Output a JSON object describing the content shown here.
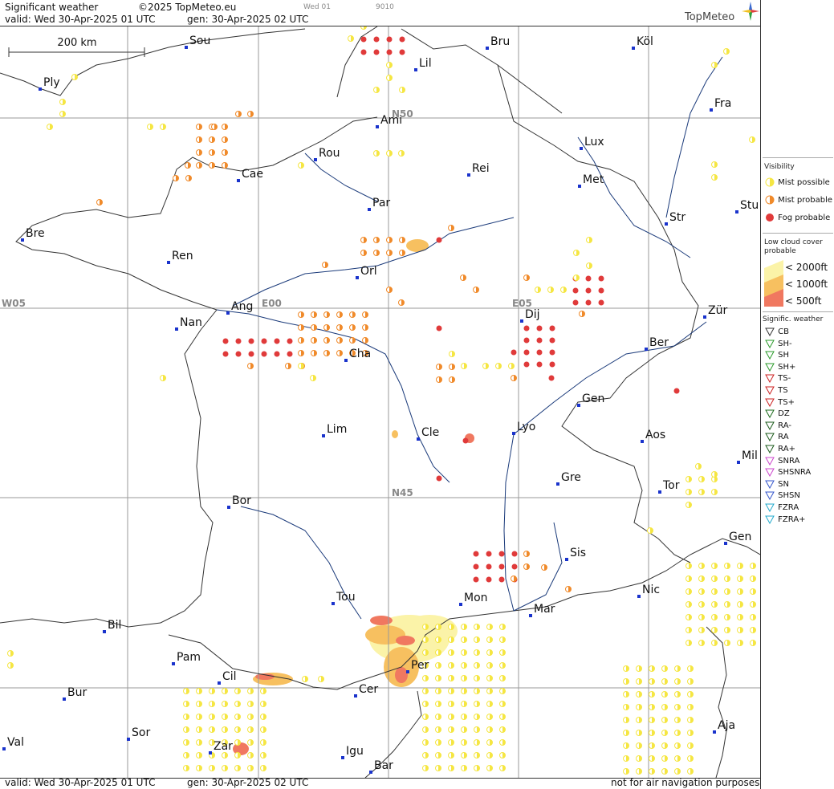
{
  "header": {
    "title": "Significant weather",
    "copyright": "©2025 TopMeteo.eu",
    "valid": "valid:  Wed  30-Apr-2025  01 UTC",
    "gen": "gen:  30-Apr-2025  02 UTC",
    "small_day": "Wed 01",
    "small_code": "9010",
    "brand": "TopMeteo"
  },
  "scale_bar": {
    "label": "200 km"
  },
  "grid_labels": [
    {
      "id": "n50",
      "text": "N50"
    },
    {
      "id": "n45",
      "text": "N45"
    },
    {
      "id": "w05",
      "text": "W05"
    },
    {
      "id": "e00",
      "text": "E00"
    },
    {
      "id": "e05",
      "text": "E05"
    }
  ],
  "cities": [
    "Sou",
    "Bru",
    "Köl",
    "Ply",
    "Lil",
    "Ami",
    "Fra",
    "Rou",
    "Lux",
    "Cae",
    "Rei",
    "Met",
    "Par",
    "Stu",
    "Bre",
    "Str",
    "Ren",
    "Orl",
    "Ang",
    "Dij",
    "Zür",
    "Nan",
    "Ber",
    "Cha",
    "Gen",
    "Lim",
    "Cle",
    "Lyo",
    "Aos",
    "Mil",
    "Gre",
    "Tor",
    "Bor",
    "Gen",
    "Sis",
    "Tou",
    "Nic",
    "Mon",
    "Mar",
    "Bil",
    "Pam",
    "Per",
    "Cil",
    "Bur",
    "Cer",
    "Sor",
    "Aja",
    "Val",
    "Zar",
    "Igu",
    "Bar"
  ],
  "legend": {
    "visibility_title": "Visibility",
    "visibility": [
      {
        "label": "Mist possible",
        "color": "#f5e642"
      },
      {
        "label": "Mist probable",
        "color": "#f08a2a"
      },
      {
        "label": "Fog probable",
        "color": "#e03a3a"
      }
    ],
    "low_cloud_title_1": "Low cloud cover",
    "low_cloud_title_2": "probable",
    "low_cloud": [
      {
        "label": "< 2000ft",
        "color": "#fbf3a8"
      },
      {
        "label": "< 1000ft",
        "color": "#f7c060"
      },
      {
        "label": "<   500ft",
        "color": "#f07860"
      }
    ],
    "sig_title": "Signific. weather",
    "sig": [
      {
        "label": "CB",
        "color": "#333333"
      },
      {
        "label": "SH-",
        "color": "#2a9a2a"
      },
      {
        "label": "SH",
        "color": "#2a9a2a"
      },
      {
        "label": "SH+",
        "color": "#2a9a2a"
      },
      {
        "label": "TS-",
        "color": "#cc2222"
      },
      {
        "label": "TS",
        "color": "#cc2222"
      },
      {
        "label": "TS+",
        "color": "#cc2222"
      },
      {
        "label": "DZ",
        "color": "#1a6a1a"
      },
      {
        "label": "RA-",
        "color": "#1a5a1a"
      },
      {
        "label": "RA",
        "color": "#1a5a1a"
      },
      {
        "label": "RA+",
        "color": "#1a5a1a"
      },
      {
        "label": "SNRA",
        "color": "#cc44cc"
      },
      {
        "label": "SHSNRA",
        "color": "#cc44cc"
      },
      {
        "label": "SN",
        "color": "#3355cc"
      },
      {
        "label": "SHSN",
        "color": "#3355cc"
      },
      {
        "label": "FZRA",
        "color": "#22aacc"
      },
      {
        "label": "FZRA+",
        "color": "#22aacc"
      }
    ]
  },
  "footer": {
    "valid": "valid:  Wed  30-Apr-2025  01 UTC",
    "gen": "gen:  30-Apr-2025  02 UTC",
    "disclaimer": "not for air navigation purposes"
  },
  "colors": {
    "mist_possible": "#f5e642",
    "mist_probable": "#f08a2a",
    "fog_probable": "#e03a3a",
    "city_marker": "#1a33cc",
    "river": "#1a3a7a",
    "border": "#333333",
    "grid": "#9a9a9a"
  }
}
